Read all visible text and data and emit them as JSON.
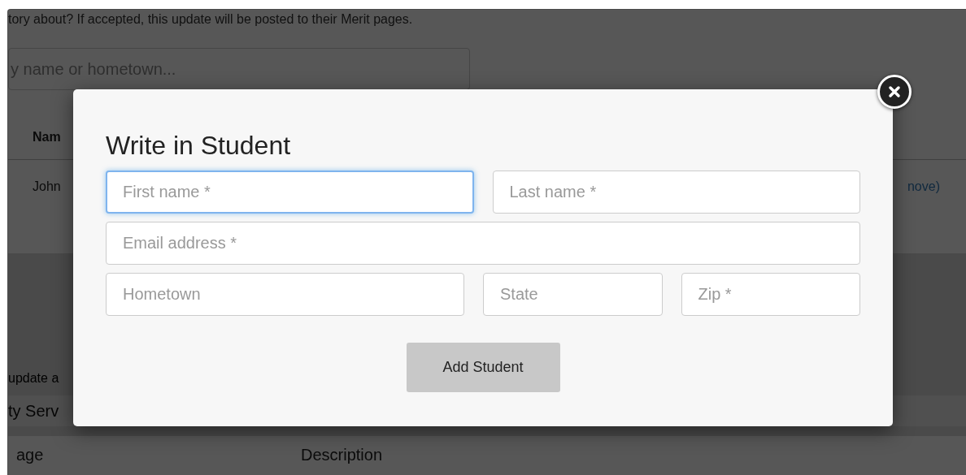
{
  "page": {
    "intro": "tory about? If accepted, this update will be posted to their Merit pages.",
    "search": {
      "placeholder": "y name or hometown..."
    },
    "table": {
      "columns": [
        "Nam"
      ],
      "rows": [
        {
          "name": "John",
          "action": "nove)"
        }
      ]
    },
    "section": {
      "hint": "update a",
      "category_value": "ty Serv",
      "labels": [
        "age",
        "Description"
      ]
    }
  },
  "modal": {
    "title": "Write in Student",
    "rows": [
      [
        {
          "placeholder": "First name *",
          "focused": true
        },
        {
          "placeholder": "Last name *",
          "focused": false
        }
      ],
      [
        {
          "placeholder": "Email address *",
          "focused": false
        }
      ],
      [
        {
          "placeholder": "Hometown",
          "focused": false
        },
        {
          "placeholder": "State",
          "focused": false
        },
        {
          "placeholder": "Zip *",
          "focused": false
        }
      ]
    ],
    "submit": "Add Student"
  }
}
